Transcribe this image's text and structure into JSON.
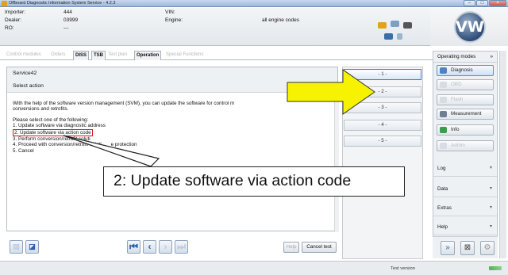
{
  "window": {
    "title": "Offboard Diagnostic Information System Service - 4.2.3"
  },
  "info": {
    "importer_label": "Importer:",
    "importer_value": "444",
    "dealer_label": "Dealer:",
    "dealer_value": "03999",
    "ro_label": "RO:",
    "ro_value": "---",
    "vin_label": "VIN:",
    "vin_value": "",
    "engine_label": "Engine:",
    "engine_value": "all engine codes"
  },
  "brand": {
    "logo_text": "VW"
  },
  "tabs": [
    {
      "label": "Control modules",
      "active": false
    },
    {
      "label": "Orders",
      "active": false
    },
    {
      "label": "DISS",
      "active": false
    },
    {
      "label": "TSB",
      "active": false
    },
    {
      "label": "Test plan",
      "active": false
    },
    {
      "label": "Operation",
      "active": true
    },
    {
      "label": "Special Functions",
      "active": false
    }
  ],
  "panel": {
    "title": "Service42",
    "subtitle": "Select action",
    "message_line1": "With the help of the software version management (SVM), you can update the software for control m",
    "message_line2": "conversions and retrofits.",
    "prompt": "Please select one of the following:",
    "options": [
      "1. Update software via diagnostic address",
      "2. Update software via action code",
      "3. Perform conversion/retrofit soluti",
      "4. Proceed with conversion/retrofit soluti",
      "5. Cancel"
    ],
    "option4_tail": "e protection",
    "selected_index": 1
  },
  "slots": [
    "- 1 -",
    "- 2 -",
    "- 3 -",
    "- 4 -",
    "- 5 -"
  ],
  "bottom": {
    "help_label": "Help",
    "cancel_label": "Cancel test"
  },
  "right": {
    "header": "Operating modes",
    "buttons": [
      {
        "label": "Diagnosis",
        "state": "active"
      },
      {
        "label": "OBD",
        "state": "disabled"
      },
      {
        "label": "Flash",
        "state": "disabled"
      },
      {
        "label": "Measurement",
        "state": "normal"
      },
      {
        "label": "Info",
        "state": "normal"
      },
      {
        "label": "Admin",
        "state": "disabled"
      }
    ],
    "sections": [
      "Log",
      "Data",
      "Extras",
      "Help"
    ]
  },
  "status": {
    "text": "Test version"
  },
  "callout": {
    "text": "2: Update software via action code"
  },
  "colors": {
    "highlight_box": "#e01818",
    "arrow_fill": "#f7f300",
    "accent": "#2d5fa8"
  }
}
